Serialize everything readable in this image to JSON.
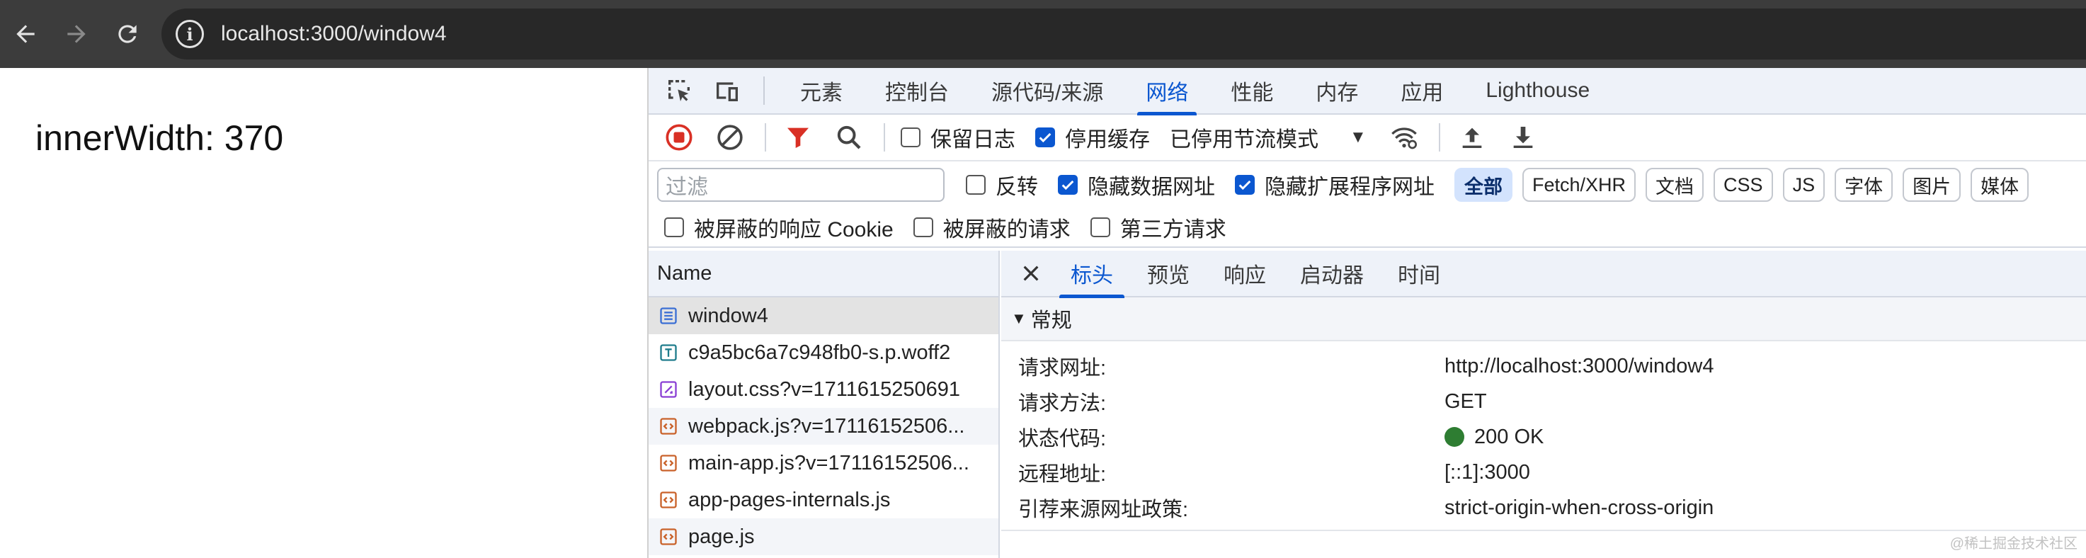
{
  "browser": {
    "url": "localhost:3000/window4"
  },
  "page": {
    "inner_width_text": "innerWidth: 370"
  },
  "devtools": {
    "tabs": [
      "元素",
      "控制台",
      "源代码/来源",
      "网络",
      "性能",
      "内存",
      "应用",
      "Lighthouse"
    ],
    "active_tab": "网络",
    "toolbar": {
      "preserve_log": "保留日志",
      "disable_cache": "停用缓存",
      "throttling": "已停用节流模式"
    },
    "filter": {
      "placeholder": "过滤",
      "invert": "反转",
      "hide_data_urls": "隐藏数据网址",
      "hide_extension_urls": "隐藏扩展程序网址",
      "types": [
        "全部",
        "Fetch/XHR",
        "文档",
        "CSS",
        "JS",
        "字体",
        "图片",
        "媒体"
      ],
      "blocked_cookies": "被屏蔽的响应 Cookie",
      "blocked_requests": "被屏蔽的请求",
      "third_party": "第三方请求"
    },
    "request_list": {
      "header": "Name",
      "rows": [
        {
          "name": "window4",
          "type": "doc"
        },
        {
          "name": "c9a5bc6a7c948fb0-s.p.woff2",
          "type": "font"
        },
        {
          "name": "layout.css?v=1711615250691",
          "type": "css"
        },
        {
          "name": "webpack.js?v=17116152506...",
          "type": "js"
        },
        {
          "name": "main-app.js?v=17116152506...",
          "type": "js"
        },
        {
          "name": "app-pages-internals.js",
          "type": "js"
        },
        {
          "name": "page.js",
          "type": "js"
        }
      ]
    },
    "details": {
      "tabs": [
        "标头",
        "预览",
        "响应",
        "启动器",
        "时间"
      ],
      "active_tab": "标头",
      "section": "常规",
      "general": [
        {
          "key": "请求网址:",
          "value": "http://localhost:3000/window4"
        },
        {
          "key": "请求方法:",
          "value": "GET"
        },
        {
          "key": "状态代码:",
          "value": "200 OK"
        },
        {
          "key": "远程地址:",
          "value": "[::1]:3000"
        },
        {
          "key": "引荐来源网址政策:",
          "value": "strict-origin-when-cross-origin"
        }
      ]
    },
    "watermark": "@稀土掘金技术社区",
    "colors": {
      "accent": "#0b57d0",
      "status_ok": "#2e7d32",
      "record": "#d93025",
      "filter": "#d93025"
    }
  }
}
